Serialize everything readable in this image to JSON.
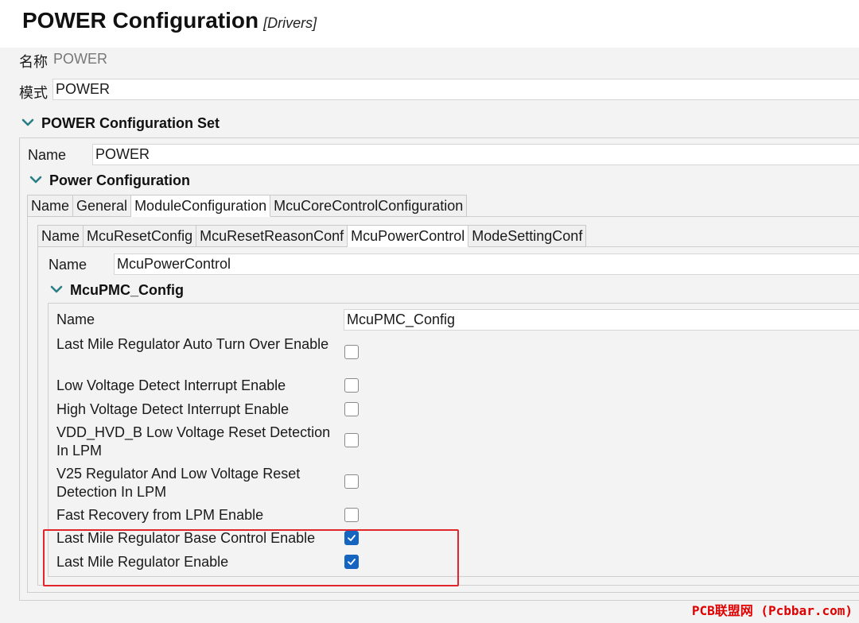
{
  "header": {
    "title": "POWER Configuration",
    "subtitle": "[Drivers]"
  },
  "top_fields": {
    "name_label": "名称",
    "name_value": "POWER",
    "mode_label": "模式",
    "mode_value": "POWER"
  },
  "config_set": {
    "title": "POWER Configuration Set",
    "name_label": "Name",
    "name_value": "POWER"
  },
  "power_configuration": {
    "title": "Power Configuration",
    "tabs": [
      "Name",
      "General",
      "ModuleConfiguration",
      "McuCoreControlConfiguration"
    ],
    "active_tab": "ModuleConfiguration"
  },
  "module_configuration": {
    "tabs": [
      "Name",
      "McuResetConfig",
      "McuResetReasonConf",
      "McuPowerControl",
      "ModeSettingConf"
    ],
    "active_tab": "McuPowerControl",
    "name_label": "Name",
    "name_value": "McuPowerControl"
  },
  "pmc_config": {
    "title": "McuPMC_Config",
    "name_label": "Name",
    "name_value": "McuPMC_Config",
    "params": [
      {
        "label": "Last Mile Regulator Auto Turn Over Enable",
        "checked": false
      },
      {
        "label": "Low Voltage Detect Interrupt Enable",
        "checked": false
      },
      {
        "label": "High Voltage Detect Interrupt Enable",
        "checked": false
      },
      {
        "label": "VDD_HVD_B Low Voltage Reset Detection In LPM",
        "checked": false
      },
      {
        "label": "V25 Regulator And Low Voltage Reset Detection In LPM",
        "checked": false
      },
      {
        "label": "Fast Recovery from LPM Enable",
        "checked": false
      },
      {
        "label": "Last Mile Regulator Base Control Enable",
        "checked": true
      },
      {
        "label": "Last Mile Regulator Enable",
        "checked": true
      }
    ]
  },
  "icons": {
    "section_toggle": "chevron-down-icon",
    "checkbox_checked": "check-icon"
  },
  "colors": {
    "accent": "#1565c0",
    "highlight": "#e0252b",
    "watermark": "#e00000"
  },
  "watermark": "PCB联盟网 (Pcbbar.com)"
}
